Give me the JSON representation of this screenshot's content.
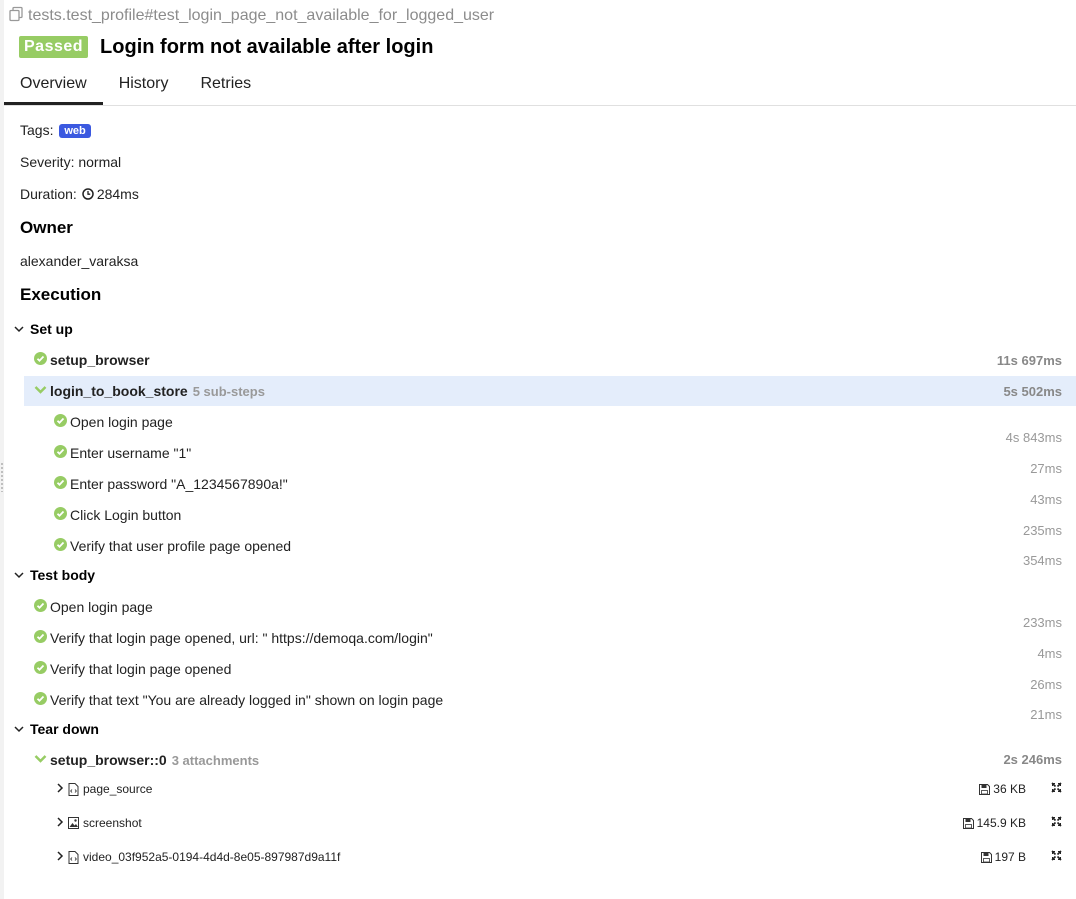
{
  "breadcrumb": "tests.test_profile#test_login_page_not_available_for_logged_user",
  "status": "Passed",
  "title": "Login form not available after login",
  "tabs": [
    "Overview",
    "History",
    "Retries"
  ],
  "tags_label": "Tags:",
  "tag": "web",
  "severity": "Severity: normal",
  "duration_label": "Duration:",
  "duration": "284ms",
  "owner_heading": "Owner",
  "owner": "alexander_varaksa",
  "execution_heading": "Execution",
  "setup": {
    "label": "Set up",
    "browser": {
      "name": "setup_browser",
      "duration": "11s 697ms"
    },
    "login": {
      "name": "login_to_book_store",
      "substeps": "5 sub-steps",
      "duration": "5s 502ms",
      "steps": [
        {
          "name": "Open login page",
          "duration": "4s 843ms"
        },
        {
          "name": "Enter username \"1\"",
          "duration": "27ms"
        },
        {
          "name": "Enter password \"A_1234567890a!\"",
          "duration": "43ms"
        },
        {
          "name": "Click Login button",
          "duration": "235ms"
        },
        {
          "name": "Verify that user profile page opened",
          "duration": "354ms"
        }
      ]
    }
  },
  "body": {
    "label": "Test body",
    "steps": [
      {
        "name": "Open login page",
        "duration": "233ms"
      },
      {
        "name": "Verify that login page opened, url: \" https://demoqa.com/login\"",
        "duration": "4ms"
      },
      {
        "name": "Verify that login page opened",
        "duration": "26ms"
      },
      {
        "name": "Verify that text \"You are already logged in\" shown on login page",
        "duration": "21ms"
      }
    ]
  },
  "teardown": {
    "label": "Tear down",
    "step": {
      "name": "setup_browser::0",
      "attachments": "3 attachments",
      "duration": "2s 246ms"
    },
    "files": [
      {
        "name": "page_source",
        "size": "36 KB",
        "icon": "code-file-icon"
      },
      {
        "name": "screenshot",
        "size": "145.9 KB",
        "icon": "image-file-icon"
      },
      {
        "name": "video_03f952a5-0194-4d4d-8e05-897987d9a11f",
        "size": "197 B",
        "icon": "code-file-icon"
      }
    ]
  },
  "colors": {
    "passed": "#97cc64",
    "tag": "#3b59e0",
    "highlight": "#e4edfb"
  }
}
